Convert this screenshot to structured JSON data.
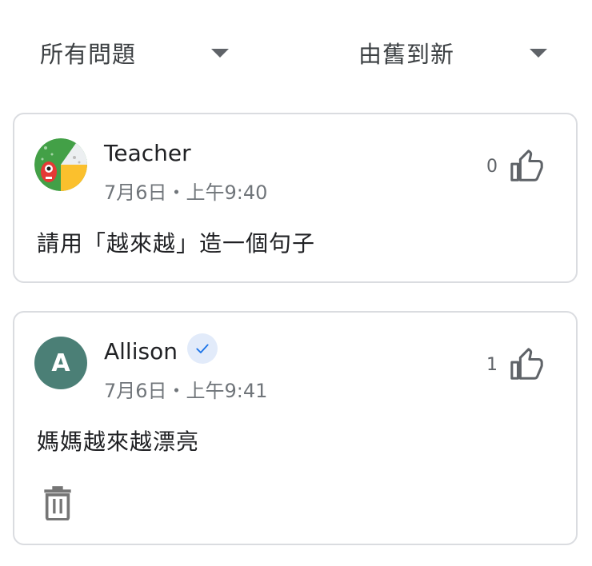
{
  "filters": {
    "questions_label": "所有問題",
    "sort_label": "由舊到新"
  },
  "posts": [
    {
      "author": "Teacher",
      "time": "7月6日・上午9:40",
      "likes": "0",
      "text": "請用「越來越」造一個句子"
    },
    {
      "author": "Allison",
      "avatar_letter": "A",
      "time": "7月6日・上午9:41",
      "likes": "1",
      "text": "媽媽越來越漂亮"
    }
  ],
  "colors": {
    "allison_avatar": "#4b7f76",
    "verified_bg": "#e2ebfa",
    "verified_check": "#1a73e8"
  }
}
